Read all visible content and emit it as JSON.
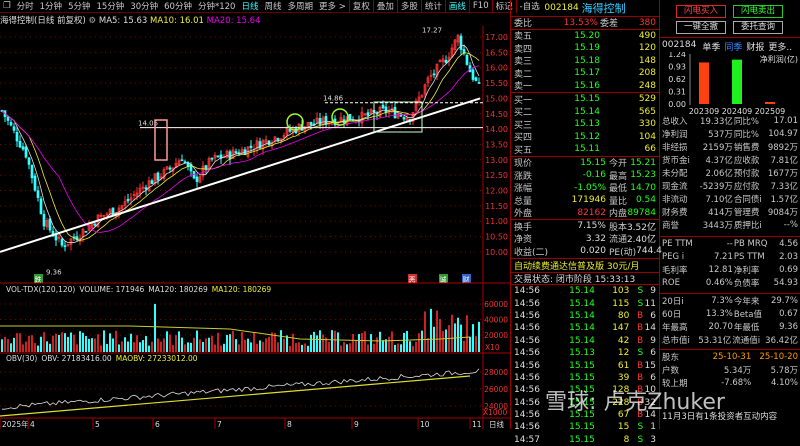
{
  "toolbar": {
    "items": [
      "分时",
      "1分钟",
      "5分钟",
      "15分钟",
      "30分钟",
      "60分钟",
      "分钟*120",
      "日线",
      "周线",
      "多周期",
      "更多 >"
    ],
    "active": "日线",
    "tools": [
      "复权",
      "叠加",
      "多股",
      "统计",
      "画线",
      "F10",
      "标记",
      "-自选"
    ]
  },
  "info": {
    "title": "海得控制(日线 前复权)",
    "ma5": "MA5: 15.63",
    "ma10": "MA10: 16.01",
    "ma20": "MA20: 15.64"
  },
  "chart_data": {
    "type": "candlestick",
    "price_axis": [
      "17.00",
      "16.50",
      "16.00",
      "15.50",
      "15.00",
      "14.50",
      "14.00",
      "13.50",
      "13.00",
      "12.50",
      "12.00",
      "11.50",
      "11.00",
      "10.50",
      "10.00"
    ],
    "ylim": [
      10,
      17
    ],
    "high_label": "17.27",
    "low_label": "9.36",
    "level_label_1": "14.05",
    "level_label_2": "14.86",
    "price_path": [
      [
        0,
        14.6
      ],
      [
        8,
        13.2
      ],
      [
        14,
        11.0
      ],
      [
        20,
        10.2
      ],
      [
        26,
        10.6
      ],
      [
        32,
        11.1
      ],
      [
        40,
        11.5
      ],
      [
        48,
        12.2
      ],
      [
        56,
        12.7
      ],
      [
        60,
        13.1
      ],
      [
        64,
        12.3
      ],
      [
        70,
        13.0
      ],
      [
        80,
        13.3
      ],
      [
        90,
        13.7
      ],
      [
        100,
        14.1
      ],
      [
        110,
        14.3
      ],
      [
        120,
        14.4
      ],
      [
        128,
        14.6
      ],
      [
        136,
        14.4
      ],
      [
        142,
        15.6
      ],
      [
        148,
        16.3
      ],
      [
        152,
        17.0
      ],
      [
        156,
        15.9
      ],
      [
        160,
        15.15
      ]
    ],
    "month_labels": [
      "2025年",
      "4",
      "5",
      "6",
      "7",
      "8",
      "9",
      "10",
      "11"
    ],
    "event_markers": [
      "跌",
      "恶",
      "诚",
      "财"
    ],
    "volume": {
      "title": "VOL-TDX(120,120)",
      "volume": "VOLUME: 171946",
      "ma120a": "MA120: 180269",
      "ma120b": "MA120: 180269",
      "axis": [
        "60000",
        "40000",
        "20000"
      ],
      "unit": "X10"
    },
    "obv": {
      "title": "OBV(30)",
      "obv": "OBV: 27183416.00",
      "maobv": "MAOBV: 27233012.00",
      "axis": [
        "28000",
        "26000",
        "24000"
      ],
      "unit": "X1000"
    },
    "period_label": "日线"
  },
  "quote": {
    "code": "002184",
    "name": "海得控制",
    "weibi_label": "委比",
    "weibi": "13.53%",
    "weicha_label": "委差",
    "weicha": "380",
    "asks": [
      {
        "l": "卖五",
        "p": "15.20",
        "v": "490"
      },
      {
        "l": "卖四",
        "p": "15.19",
        "v": "120"
      },
      {
        "l": "卖三",
        "p": "15.18",
        "v": "148"
      },
      {
        "l": "卖二",
        "p": "15.17",
        "v": "208"
      },
      {
        "l": "卖一",
        "p": "15.16",
        "v": "248"
      }
    ],
    "bids": [
      {
        "l": "买一",
        "p": "15.15",
        "v": "529"
      },
      {
        "l": "买二",
        "p": "15.14",
        "v": "565"
      },
      {
        "l": "买三",
        "p": "15.13",
        "v": "330"
      },
      {
        "l": "买四",
        "p": "15.12",
        "v": "104"
      },
      {
        "l": "买五",
        "p": "15.11",
        "v": "66"
      }
    ],
    "stats": [
      [
        "现价",
        "15.15",
        "今开",
        "15.21"
      ],
      [
        "涨跌",
        "-0.16",
        "最高",
        "15.23"
      ],
      [
        "涨幅",
        "-1.05%",
        "最低",
        "14.70"
      ],
      [
        "总量",
        "171946",
        "量比",
        "0.54"
      ],
      [
        "外盘",
        "82162",
        "内盘",
        "89784"
      ]
    ],
    "stats2": [
      [
        "换手",
        "7.15%",
        "股本",
        "3.52亿"
      ],
      [
        "净资",
        "3.32",
        "流通",
        "2.40亿"
      ],
      [
        "收益(二)",
        "0.020",
        "PE(动)",
        "744.4"
      ]
    ],
    "ad": "自动续费通达信普及版",
    "ad_price": "30元/月",
    "status": "交易状态: 闭市阶段 15:33:13",
    "trades": [
      [
        "14:56",
        "15.14",
        "103",
        "S",
        "9"
      ],
      [
        "14:56",
        "15.14",
        "115",
        "S",
        "11"
      ],
      [
        "14:56",
        "15.14",
        "80",
        "B",
        "6"
      ],
      [
        "14:56",
        "15.14",
        "147",
        "B",
        "14"
      ],
      [
        "14:56",
        "15.14",
        "42",
        "B",
        "9"
      ],
      [
        "14:56",
        "15.13",
        "12",
        "S",
        "6"
      ],
      [
        "14:56",
        "15.15",
        "61",
        "B",
        "15"
      ],
      [
        "14:56",
        "15.15",
        "39",
        "B",
        "6"
      ],
      [
        "14:56",
        "15.15",
        "128",
        "B",
        "10"
      ],
      [
        "14:56",
        "15.15",
        "228",
        "B",
        "32"
      ],
      [
        "14:56",
        "15.15",
        "67",
        "B",
        "14"
      ],
      [
        "14:56",
        "15.15",
        "15",
        "S",
        "1"
      ],
      [
        "14:57",
        "15.15",
        "8",
        "S",
        "3"
      ]
    ]
  },
  "side": {
    "buttons": [
      "闪电买入",
      "闪电卖出",
      "一键全撤",
      "委托查询"
    ],
    "code": "002184",
    "tabs": [
      "单季",
      "同季",
      "财报",
      "更多.."
    ],
    "active_tab": "同季",
    "chart_title": "净利润(亿)",
    "y_ticks": [
      "1.24",
      "0.93",
      "0.62",
      "0.31",
      "0.00"
    ],
    "bars": [
      {
        "period": "202309",
        "value": 1.03,
        "color": "#ff4010"
      },
      {
        "period": "202409",
        "value": 1.1,
        "color": "#20f020"
      },
      {
        "period": "202509",
        "value": 0.05,
        "color": "#ff4010"
      }
    ],
    "fin": [
      [
        "总收入",
        "19.33亿",
        "同比%",
        "17.01"
      ],
      [
        "净利润",
        "537万",
        "同比%",
        "104.97"
      ],
      [
        "非经损",
        "2159万",
        "销售费",
        "9892万"
      ],
      [
        "货币金i",
        "4.37亿",
        "应收款",
        "7.81亿"
      ],
      [
        "未分配",
        "2.06亿",
        "预付款",
        "1677万"
      ],
      [
        "现金流",
        "-5239万",
        "应付款",
        "7.33亿"
      ],
      [
        "非流动",
        "7.10亿",
        "合同债i",
        "1.57亿"
      ],
      [
        "财务费",
        "414万",
        "管理费",
        "9084万"
      ],
      [
        "商誉",
        "3443万",
        "质押比i",
        "--%"
      ]
    ],
    "val": [
      [
        "PE TTM",
        "--",
        "PB MRQ",
        "4.56"
      ],
      [
        "PEG i",
        "7.21",
        "PS TTM",
        "2.03"
      ],
      [
        "毛利率",
        "12.81",
        "净利率",
        "0.69"
      ],
      [
        "ROE",
        "0.46%",
        "负债率",
        "54.93"
      ]
    ],
    "perf": [
      [
        "20日i",
        "7.3%",
        "今年来",
        "29.7%"
      ],
      [
        "60日",
        "13.3%",
        "Beta值",
        "0.67"
      ],
      [
        "年最高",
        "20.70",
        "年最低",
        "9.36"
      ],
      [
        "总市值i",
        "53.31亿",
        "流通值i",
        "36.42亿"
      ]
    ],
    "holders": [
      [
        "股东",
        "25-10-31",
        "25-10-20"
      ],
      [
        "户数",
        "5.34万",
        "5.78万"
      ],
      [
        "较上期",
        "-7.68%",
        "4.10%"
      ]
    ],
    "notice": "11月3日有1条投资者互动内容",
    "watermark": "雪球: 卢克Zhuker"
  }
}
